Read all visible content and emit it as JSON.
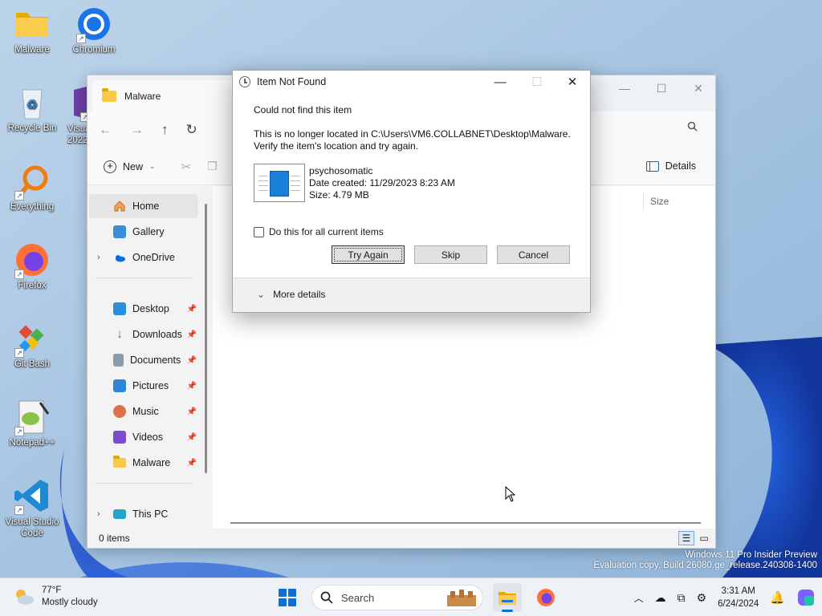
{
  "desktop": {
    "icons": [
      {
        "label": "Malware",
        "icon": "folder-icon"
      },
      {
        "label": "Chromium",
        "icon": "chromium-icon"
      },
      {
        "label": "Recycle Bin",
        "icon": "recycle-bin-icon"
      },
      {
        "label": "Visua 2022",
        "icon": "visual-studio-icon"
      },
      {
        "label": "Everything",
        "icon": "everything-icon"
      },
      {
        "label": "Firefox",
        "icon": "firefox-icon"
      },
      {
        "label": "Git Bash",
        "icon": "git-bash-icon"
      },
      {
        "label": "Notepad++",
        "icon": "notepadpp-icon"
      },
      {
        "label": "Visual Studio Code",
        "icon": "vscode-icon"
      }
    ],
    "watermark": {
      "line1": "Windows 11 Pro Insider Preview",
      "line2": "Evaluation copy. Build 26080.ge_release.240308-1400"
    }
  },
  "explorer": {
    "tab_title": "Malware",
    "toolbar": {
      "new_label": "New",
      "details_label": "Details"
    },
    "sidebar": {
      "items": [
        {
          "label": "Home",
          "icon": "home-icon",
          "selected": true
        },
        {
          "label": "Gallery",
          "icon": "gallery-icon"
        },
        {
          "label": "OneDrive",
          "icon": "onedrive-icon",
          "expandable": true
        },
        {
          "label": "Desktop",
          "icon": "desktop-icon",
          "pinned": true
        },
        {
          "label": "Downloads",
          "icon": "downloads-icon",
          "pinned": true
        },
        {
          "label": "Documents",
          "icon": "documents-icon",
          "pinned": true
        },
        {
          "label": "Pictures",
          "icon": "pictures-icon",
          "pinned": true
        },
        {
          "label": "Music",
          "icon": "music-icon",
          "pinned": true
        },
        {
          "label": "Videos",
          "icon": "videos-icon",
          "pinned": true
        },
        {
          "label": "Malware",
          "icon": "folder-icon",
          "pinned": true
        },
        {
          "label": "This PC",
          "icon": "this-pc-icon",
          "expandable": true
        }
      ]
    },
    "columns": {
      "size": "Size"
    },
    "status": {
      "items": "0 items"
    }
  },
  "dialog": {
    "title": "Item Not Found",
    "heading": "Could not find this item",
    "message_line1": "This is no longer located in C:\\Users\\VM6.COLLABNET\\Desktop\\Malware.",
    "message_line2": "Verify the item's location and try again.",
    "file": {
      "name": "psychosomatic",
      "date_created": "Date created: 11/29/2023 8:23 AM",
      "size": "Size: 4.79 MB"
    },
    "checkbox_label": "Do this for all current items",
    "buttons": {
      "try_again": "Try Again",
      "skip": "Skip",
      "cancel": "Cancel"
    },
    "more_details": "More details"
  },
  "taskbar": {
    "weather": {
      "temp": "77°F",
      "condition": "Mostly cloudy"
    },
    "search_label": "Search",
    "clock": {
      "time": "3:31 AM",
      "date": "6/24/2024"
    }
  },
  "colors": {
    "accent": "#0a6fd6",
    "wallpaper": "#9fc1e0",
    "bloom": "#1d4fd0"
  }
}
